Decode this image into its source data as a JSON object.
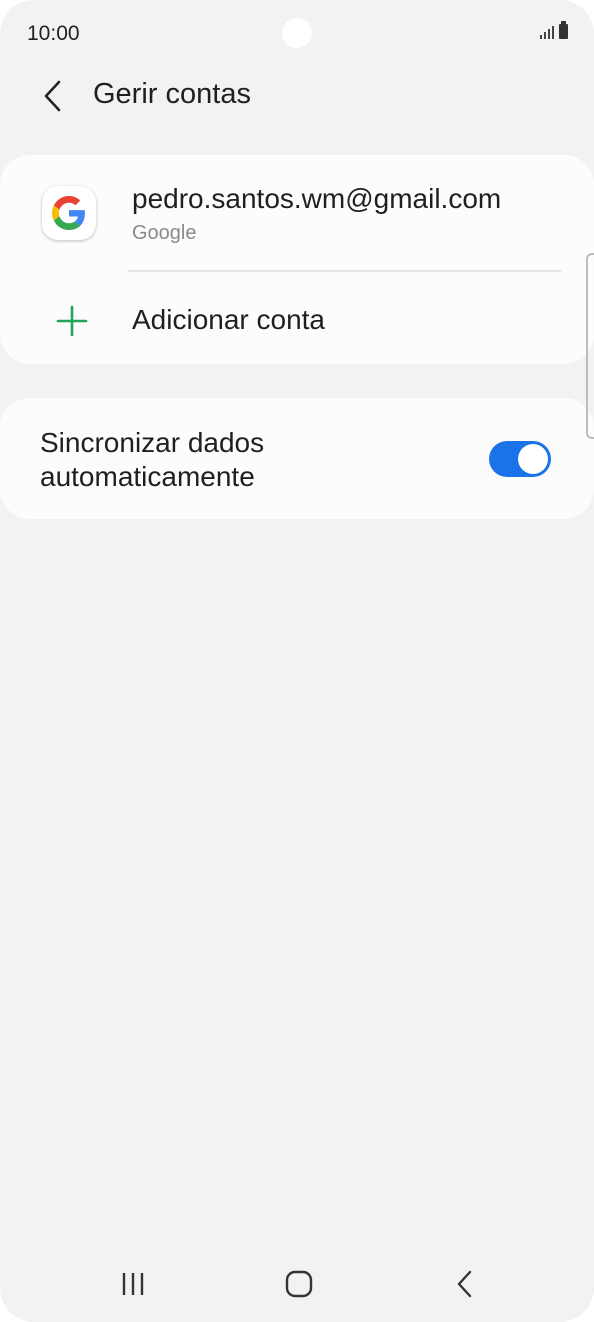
{
  "status_bar": {
    "time": "10:00"
  },
  "header": {
    "title": "Gerir contas",
    "back_icon": "chevron-left-icon"
  },
  "accounts": [
    {
      "email": "pedro.santos.wm@gmail.com",
      "type": "Google",
      "icon": "google-icon"
    }
  ],
  "add_account": {
    "label": "Adicionar conta",
    "icon": "plus-icon",
    "icon_color": "#1fa65a"
  },
  "sync": {
    "label": "Sincronizar dados automaticamente",
    "enabled": true,
    "accent_color": "#1a73e8"
  },
  "nav_bar": {
    "recents_icon": "recents-icon",
    "home_icon": "home-icon",
    "back_icon": "back-icon"
  }
}
